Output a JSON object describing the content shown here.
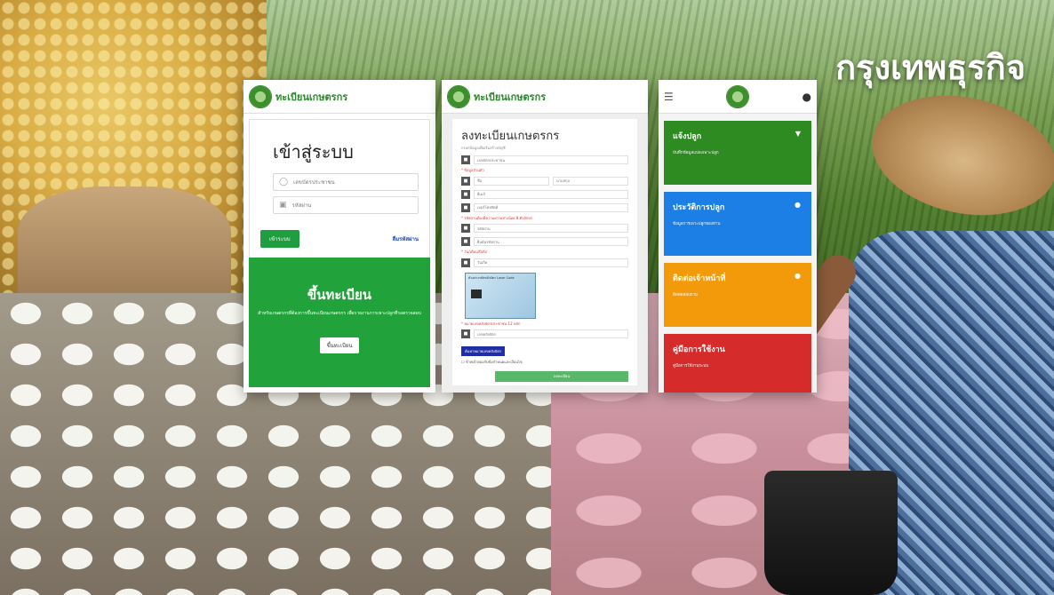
{
  "brand": "กรุงเทพธุรกิจ",
  "colors": {
    "green": "#22a23a",
    "blue": "#1c7fe6",
    "orange": "#f39a0a",
    "red": "#d62b2b"
  },
  "login_screen": {
    "header_title": "ทะเบียนเกษตรกร",
    "title": "เข้าสู่ระบบ",
    "id_placeholder": "เลขบัตรประชาชน",
    "password_placeholder": "รหัสผ่าน",
    "login_button": "เข้าระบบ",
    "forgot_link": "ลืมรหัสผ่าน",
    "register_title": "ขึ้นทะเบียน",
    "register_desc": "สำหรับเกษตรกรที่ต้องการขึ้นทะเบียนเกษตรกร เพื่อรายงานการเพาะปลูกที่รอตรวจสอบ",
    "register_button": "ขึ้นทะเบียน"
  },
  "register_screen": {
    "header_title": "ทะเบียนเกษตรกร",
    "title": "ลงทะเบียนเกษตรกร",
    "subtitle": "กรอกข้อมูลเพื่อเริ่มสร้างบัญชี",
    "fields": [
      "เลขบัตรประชาชน",
      "ชื่อ",
      "นามสกุล",
      "อีเมล์",
      "เบอร์โทรศัพท์",
      "รหัสผ่าน",
      "ยืนยันรหัสผ่าน",
      "วันเกิด",
      "เลขหลังบัตร"
    ],
    "note_name": "* ข้อมูลส่วนตัว",
    "note_password": "* รหัสผ่านต้องมีความยาวอย่างน้อย 8 ตัวอักษร",
    "note_birth": "* วัน/เดือน/ปีเกิด",
    "note_laser": "* หมายเลขหลังบัตรประชาชน 12 หลัก",
    "id_card_caption": "ตัวอย่างรหัสหลังบัตร Laser Code",
    "search_button": "ค้นหาหมายเลขหลังบัตร",
    "consent": "ข้าพเจ้ายอมรับข้อกำหนดและเงื่อนไข",
    "submit": "ลงทะเบียน"
  },
  "menu_screen": {
    "tiles": [
      {
        "title": "แจ้งปลูก",
        "sub": "บันทึกข้อมูลแปลงเพาะปลูก",
        "color": "green"
      },
      {
        "title": "ประวัติการปลูก",
        "sub": "ข้อมูลการเพาะปลูกของท่าน",
        "color": "blue"
      },
      {
        "title": "ติดต่อเจ้าหน้าที่",
        "sub": "ติดต่อสอบถาม",
        "color": "orange"
      },
      {
        "title": "คู่มือการใช้งาน",
        "sub": "คู่มือการใช้งานระบบ",
        "color": "red"
      }
    ]
  }
}
